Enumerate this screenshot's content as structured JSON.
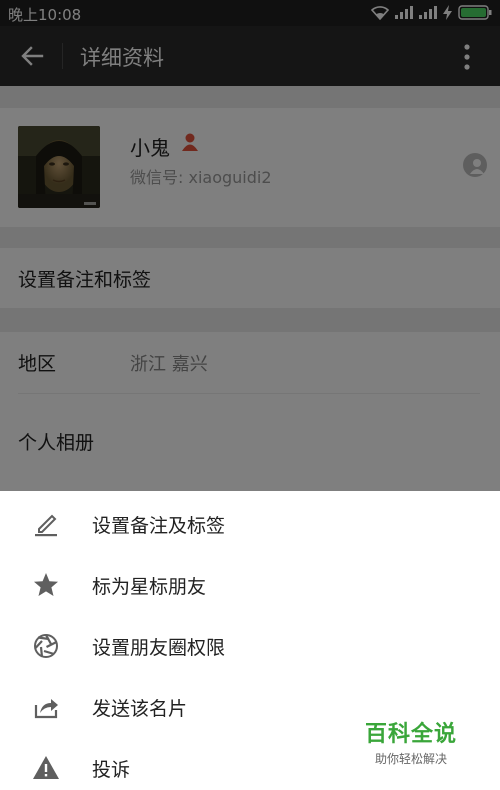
{
  "status_bar": {
    "time": "晚上10:08"
  },
  "app_bar": {
    "title": "详细资料"
  },
  "profile": {
    "name": "小鬼",
    "wechat_id": "微信号: xiaoguidi2"
  },
  "remark_row": {
    "label": "设置备注和标签"
  },
  "region": {
    "label": "地区",
    "value": "浙江  嘉兴"
  },
  "album": {
    "label": "个人相册"
  },
  "sheet": {
    "items": [
      {
        "label": "设置备注及标签",
        "icon": "pencil-icon"
      },
      {
        "label": "标为星标朋友",
        "icon": "star-icon"
      },
      {
        "label": "设置朋友圈权限",
        "icon": "aperture-icon"
      },
      {
        "label": "发送该名片",
        "icon": "share-icon"
      },
      {
        "label": "投诉",
        "icon": "warning-icon"
      }
    ]
  },
  "watermark": {
    "title": "百科全说",
    "subtitle": "助你轻松解决"
  },
  "colors": {
    "gender_icon": "#e2533c",
    "watermark_green": "#3aa63a",
    "sheet_icon": "#5f5f5f",
    "battery": "#4cd964"
  }
}
